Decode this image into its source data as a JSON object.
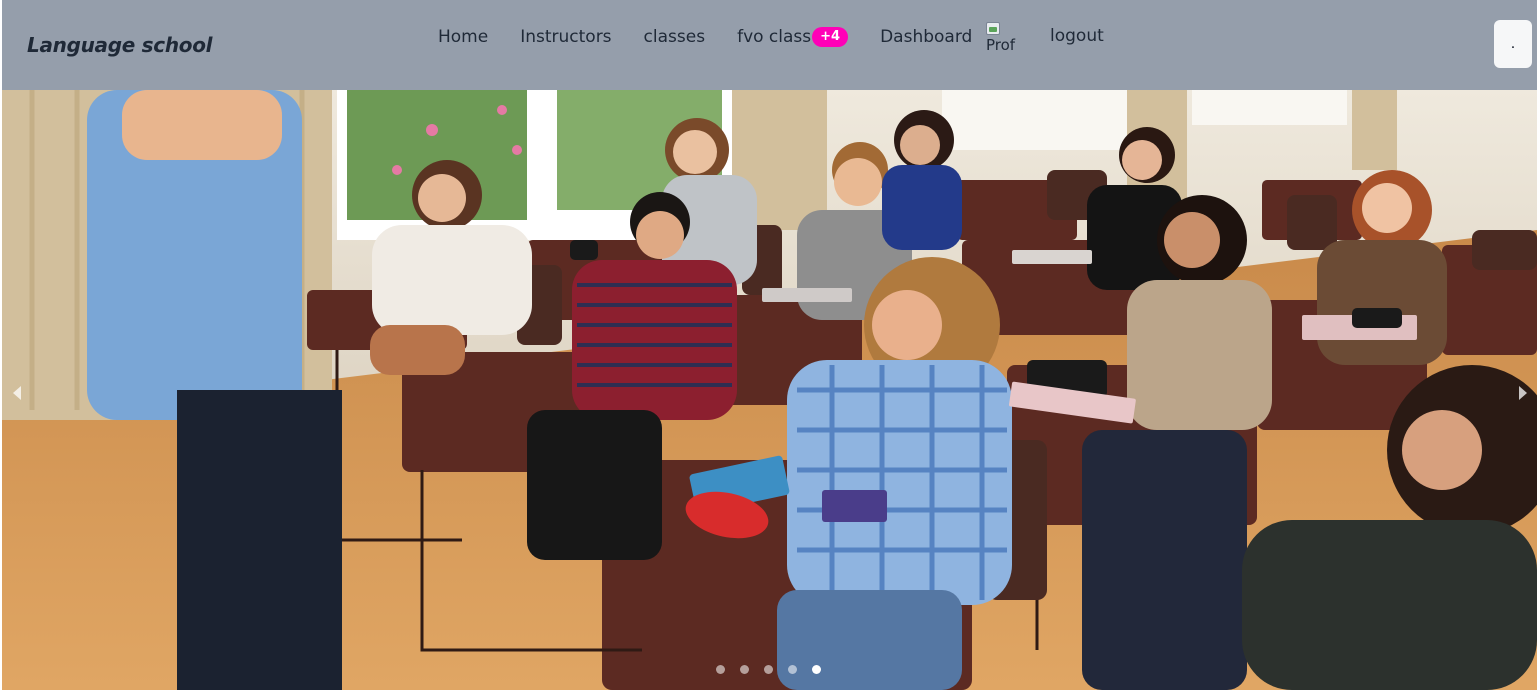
{
  "brand": "Language school",
  "nav": {
    "home": "Home",
    "instructors": "Instructors",
    "classes": "classes",
    "fvo_class": "fvo class",
    "fvo_badge": "+4",
    "dashboard": "Dashboard",
    "profile_alt": "Prof",
    "logout": "logout"
  },
  "menu_button": ".",
  "carousel": {
    "slide_count": 5,
    "active_slide": 5,
    "image_description_icon": "classroom-photo"
  },
  "colors": {
    "navbar": "#959eab",
    "badge": "#ff00b7",
    "text": "#1f2937"
  }
}
